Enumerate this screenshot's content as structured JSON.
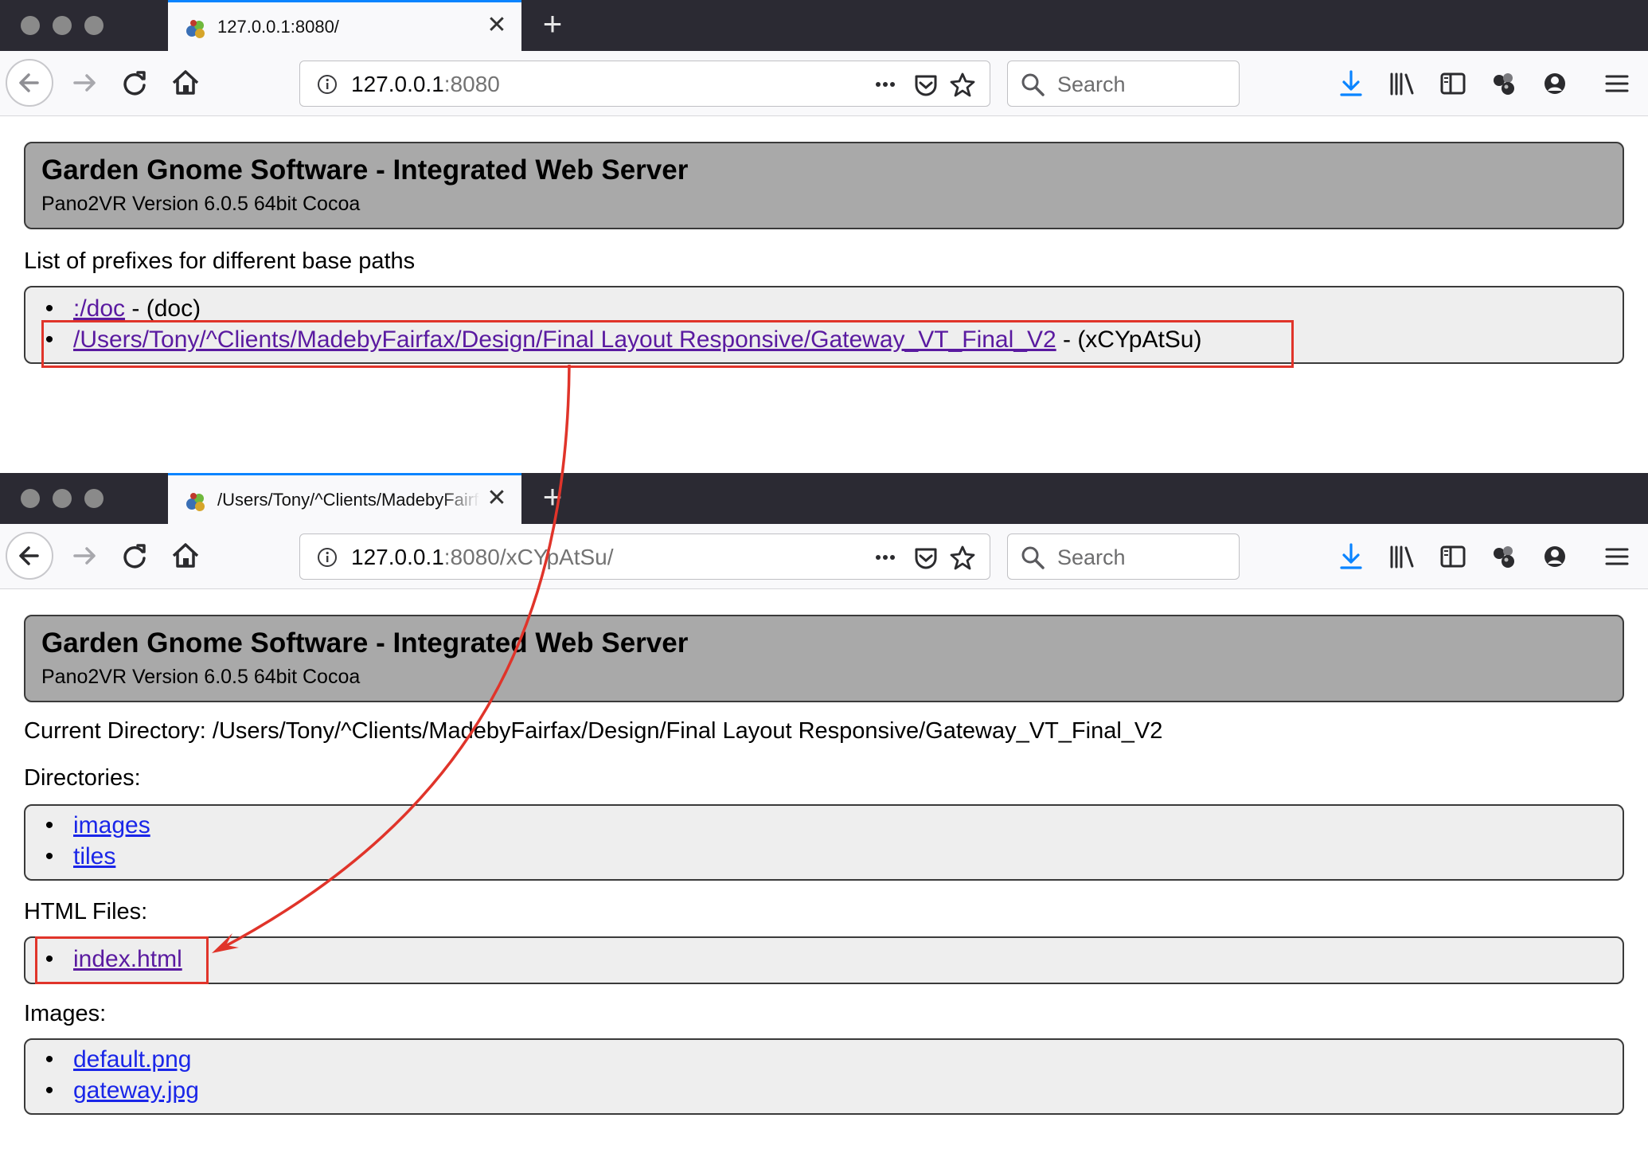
{
  "windows": [
    {
      "tab": {
        "title": "127.0.0.1:8080/"
      },
      "url": {
        "host": "127.0.0.1",
        "rest": ":8080"
      },
      "search": {
        "placeholder": "Search"
      },
      "page": {
        "header": {
          "title": "Garden Gnome Software - Integrated Web Server",
          "subtitle": "Pano2VR Version 6.0.5 64bit Cocoa"
        },
        "prefix_label": "List of prefixes for different base paths",
        "prefixes": [
          {
            "link": ":/doc",
            "suffix": " - (doc)"
          },
          {
            "link": "/Users/Tony/^Clients/MadebyFairfax/Design/Final Layout Responsive/Gateway_VT_Final_V2",
            "suffix": " - (xCYpAtSu)"
          }
        ]
      }
    },
    {
      "tab": {
        "title": "/Users/Tony/^Clients/MadebyFairfax"
      },
      "url": {
        "host": "127.0.0.1",
        "rest": ":8080/xCYpAtSu/"
      },
      "search": {
        "placeholder": "Search"
      },
      "page": {
        "header": {
          "title": "Garden Gnome Software - Integrated Web Server",
          "subtitle": "Pano2VR Version 6.0.5 64bit Cocoa"
        },
        "current_directory": "Current Directory: /Users/Tony/^Clients/MadebyFairfax/Design/Final Layout Responsive/Gateway_VT_Final_V2",
        "directories_label": "Directories:",
        "directories": [
          "images",
          "tiles"
        ],
        "html_label": "HTML Files:",
        "html_files": [
          "index.html"
        ],
        "images_label": "Images:",
        "images": [
          "default.png",
          "gateway.jpg"
        ]
      }
    }
  ],
  "annotation": {
    "color": "#e0342a",
    "icon": "arrow-annotation"
  },
  "colors": {
    "tab_accent": "#0a84ff",
    "download_icon": "#0a84ff",
    "visited_link": "#5a1aa0",
    "link": "#1a26e8"
  }
}
